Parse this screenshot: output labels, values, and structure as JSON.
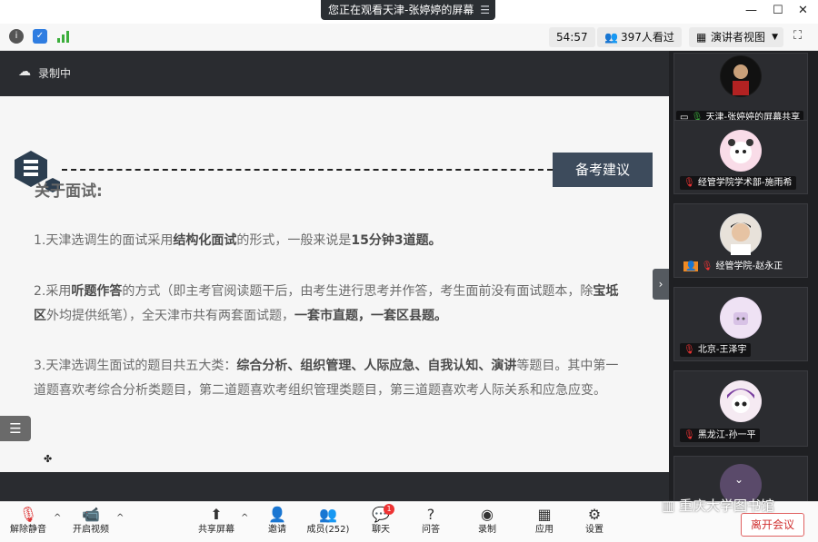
{
  "titlebar": {
    "share_status": "您正在观看天津-张婷婷的屏幕"
  },
  "infobar": {
    "timer": "54:57",
    "viewers": "397人看过",
    "view_mode": "演讲者视图"
  },
  "recording": {
    "label": "录制中"
  },
  "slide": {
    "badge": "备考建议",
    "title": "关于面试:",
    "p1": {
      "a": "1.天津选调生的面试采用",
      "b": "结构化面试",
      "c": "的形式，一般来说是",
      "d": "15分钟3道题。"
    },
    "p2": {
      "a": "2.采用",
      "b": "听题作答",
      "c": "的方式（即主考官阅读题干后，由考生进行思考并作答，考生面前没有面试题本，除",
      "d": "宝坻区",
      "e": "外均提供纸笔），全天津市共有两套面试题，",
      "f": "一套市直题，一套区县题。"
    },
    "p3": {
      "a": "3.天津选调生面试的题目共五大类：",
      "b": "综合分析、组织管理、人际应急、自我认知、演讲",
      "c": "等题目。其中第一道题喜欢考综合分析类题目，第二道题喜欢考组织管理类题目，第三道题喜欢考人际关系和应急应变。"
    }
  },
  "gallery": [
    {
      "name": "天津-张婷婷的屏幕共享"
    },
    {
      "name": "经管学院学术部-施雨希"
    },
    {
      "name": "经管学院-赵永正"
    },
    {
      "name": "北京-王泽宇"
    },
    {
      "name": "黑龙江-孙一平"
    }
  ],
  "toolbar": {
    "mute": "解除静音",
    "video": "开启视频",
    "share": "共享屏幕",
    "invite": "邀请",
    "members": "成员(252)",
    "chat": "聊天",
    "chat_badge": "1",
    "qa": "问答",
    "record": "录制",
    "apps": "应用",
    "settings": "设置",
    "leave": "离开会议"
  },
  "watermark": "重庆大学图书馆"
}
